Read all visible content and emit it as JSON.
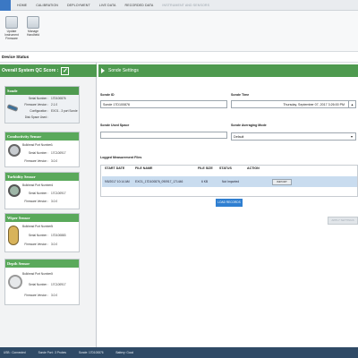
{
  "menu": {
    "file_label": "",
    "items": [
      {
        "label": "HOME",
        "enabled": true
      },
      {
        "label": "CALIBRATION",
        "enabled": true
      },
      {
        "label": "DEPLOYMENT",
        "enabled": true
      },
      {
        "label": "LIVE DATA",
        "enabled": true
      },
      {
        "label": "RECORDED DATA",
        "enabled": true
      },
      {
        "label": "INSTRUMENT AND SENSORS",
        "enabled": false
      }
    ]
  },
  "ribbon": {
    "buttons": [
      {
        "label": "Update Instrument Firmware",
        "icon": "firmware-icon"
      },
      {
        "label": "Manage Handheld",
        "icon": "handheld-icon"
      }
    ]
  },
  "device_status": {
    "title": "Device Status"
  },
  "left": {
    "qc_title": "Overall System QC Score :",
    "qc_check": "✓",
    "sonde": {
      "title": "Sonde",
      "rows": [
        {
          "label": "Serial Number :",
          "value": "17D100876"
        },
        {
          "label": "Firmware Version :",
          "value": "2.1.0"
        },
        {
          "label": "Configuration :",
          "value": "EXO1 - 3 port Sonde"
        },
        {
          "label": "Disk Space Used :",
          "value": ""
        }
      ]
    },
    "sensors": [
      {
        "title": "Conductivity Sensor",
        "icon": "conductivity-sensor-icon",
        "rows": [
          {
            "label": "Bulkhead Port Number :",
            "value": "1"
          },
          {
            "label": "Serial Number :",
            "value": "17C100917"
          },
          {
            "label": "Firmware Version :",
            "value": "3.0.0"
          }
        ]
      },
      {
        "title": "Turbidity Sensor",
        "icon": "turbidity-sensor-icon",
        "rows": [
          {
            "label": "Bulkhead Port Number :",
            "value": "4"
          },
          {
            "label": "Serial Number :",
            "value": "17C100917"
          },
          {
            "label": "Firmware Version :",
            "value": "3.0.0"
          }
        ]
      },
      {
        "title": "Wiper Sensor",
        "icon": "wiper-sensor-icon",
        "rows": [
          {
            "label": "Bulkhead Port Number :",
            "value": "5"
          },
          {
            "label": "Serial Number :",
            "value": "17D100883"
          },
          {
            "label": "Firmware Version :",
            "value": "3.0.0"
          }
        ]
      },
      {
        "title": "Depth Sensor",
        "icon": "depth-sensor-icon",
        "rows": [
          {
            "label": "Bulkhead Port Number :",
            "value": "0"
          },
          {
            "label": "Serial Number :",
            "value": "17C100917"
          },
          {
            "label": "Firmware Version :",
            "value": "3.0.0"
          }
        ]
      }
    ]
  },
  "main": {
    "header": "Sonde Settings",
    "sonde_id_label": "Sonde ID",
    "sonde_id_value": "Sonde 17D100876",
    "sonde_time_label": "Sonde Time",
    "sonde_time_value": "Thursday, September 07, 2017 3:26:00 PM",
    "used_space_label": "Sonde Used Space",
    "used_space_fraction": 0.0,
    "averaging_label": "Sonde Averaging Mode",
    "averaging_value": "Default",
    "logged_files_label": "Logged Measurement Files",
    "table": {
      "headers": [
        "START DATE",
        "FILE NAME",
        "FILE SIZE",
        "STATUS",
        "ACTION"
      ],
      "rows": [
        {
          "start_date": "9/5/2017 10:14 AM",
          "file_name": "EXO1_17D100876_090917_171446",
          "file_size": "6 KB",
          "status": "Not Imported",
          "action": "IMPORT"
        }
      ]
    },
    "load_button": "LOAD RECORDS",
    "apply_button": "APPLY SETTINGS"
  },
  "status_bar": {
    "items": [
      "USB : Connected",
      "Sonde Port : 3 Probes",
      "Sonde: 17D100876",
      "Battery: Good"
    ]
  }
}
